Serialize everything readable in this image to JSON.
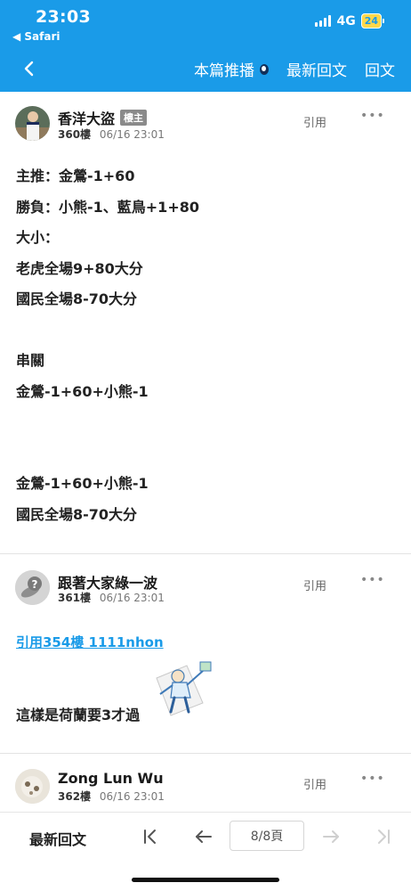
{
  "status_bar": {
    "time": "23:03",
    "back_label": "◀ Safari",
    "network": "4G",
    "battery": "24"
  },
  "nav": {
    "items": [
      "本篇推播",
      "最新回文",
      "回文"
    ]
  },
  "posts": [
    {
      "author": "香洋大盜",
      "badge": "樓主",
      "floor": "360樓",
      "time": "06/16 23:01",
      "quote_label": "引用",
      "lines": [
        "主推：金鶯-1+60",
        "勝負：小熊-1、藍鳥+1+80",
        "大小：",
        "老虎全場9+80大分",
        "國民全場8-70大分",
        "",
        "串關",
        "金鶯-1+60+小熊-1",
        "",
        "",
        "金鶯-1+60+小熊-1",
        "國民全場8-70大分"
      ]
    },
    {
      "author": "跟著大家綠一波",
      "floor": "361樓",
      "time": "06/16 23:01",
      "quote_label": "引用",
      "quote_link": "引用354樓 1111nhon",
      "text": "這樣是荷蘭要3才過"
    },
    {
      "author": "Zong Lun Wu",
      "floor": "362樓",
      "time": "06/16 23:01",
      "quote_label": "引用"
    }
  ],
  "toolbar": {
    "latest_label": "最新回文",
    "page_label": "8/8頁"
  },
  "colors": {
    "accent": "#1a9be8",
    "badge": "#8a8a8a"
  },
  "icons": [
    "back-chevron-icon",
    "live-dot-icon",
    "more-icon",
    "first-page-icon",
    "prev-page-icon",
    "next-page-icon",
    "last-page-icon"
  ]
}
